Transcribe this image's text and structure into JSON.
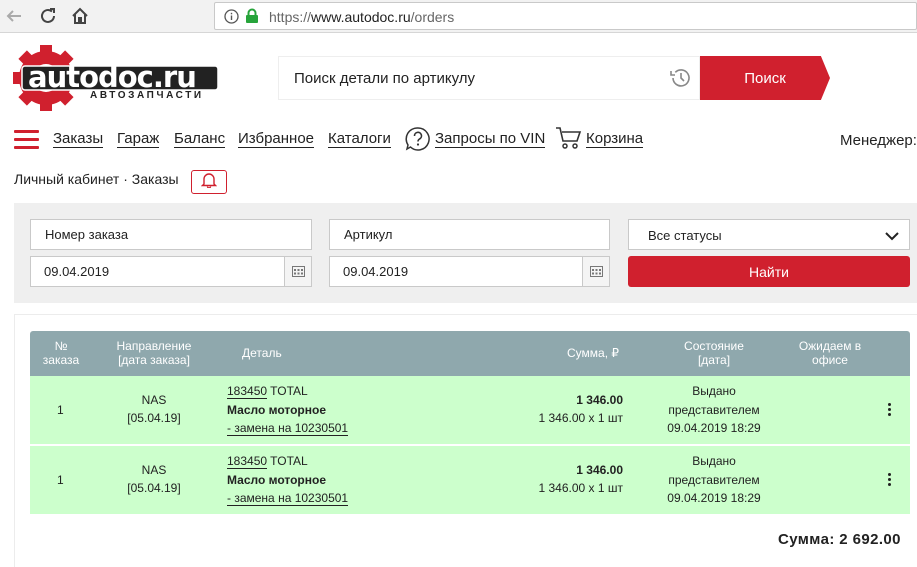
{
  "browser": {
    "url_scheme": "https://",
    "url_host": "www.autodoc.ru",
    "url_path": "/orders"
  },
  "brand": {
    "logo_text": "autodoc.ru",
    "logo_tagline": "АВТОЗАПЧАСТИ",
    "accent_color": "#d0202e"
  },
  "search": {
    "placeholder": "Поиск детали по артикулу",
    "button_label": "Поиск"
  },
  "nav": {
    "items": [
      "Заказы",
      "Гараж",
      "Баланс",
      "Избранное",
      "Каталоги"
    ],
    "vin_label": "Запросы по VIN",
    "cart_label": "Корзина",
    "manager_label": "Менеджер:"
  },
  "breadcrumb": "Личный кабинет · Заказы",
  "filters": {
    "order_number_placeholder": "Номер заказа",
    "article_placeholder": "Артикул",
    "date_from": "09.04.2019",
    "date_to": "09.04.2019",
    "status_selected": "Все статусы",
    "find_button_label": "Найти"
  },
  "table": {
    "header_color": "#8fa8ad",
    "row_color": "#ccffcc",
    "columns": {
      "number_line1": "№",
      "number_line2": "заказа",
      "direction_line1": "Направление",
      "direction_line2": "[дата заказа]",
      "detail": "Деталь",
      "sum": "Сумма, ₽",
      "state_line1": "Состояние",
      "state_line2": "[дата]",
      "expect_line1": "Ожидаем в",
      "expect_line2": "офисе"
    },
    "rows": [
      {
        "number": "1",
        "direction": "NAS",
        "order_date": "[05.04.19]",
        "article": "183450",
        "brand": " TOTAL",
        "name": "Масло моторное",
        "replacement": "- замена на 10230501",
        "sum": "1 346.00",
        "price_qty": "1 346.00 x 1 шт",
        "state_line1": "Выдано",
        "state_line2": "представителем",
        "state_date": "09.04.2019 18:29"
      },
      {
        "number": "1",
        "direction": "NAS",
        "order_date": "[05.04.19]",
        "article": "183450",
        "brand": " TOTAL",
        "name": "Масло моторное",
        "replacement": "- замена на 10230501",
        "sum": "1 346.00",
        "price_qty": "1 346.00 x 1 шт",
        "state_line1": "Выдано",
        "state_line2": "представителем",
        "state_date": "09.04.2019 18:29"
      }
    ],
    "total": "Сумма: 2 692.00"
  }
}
